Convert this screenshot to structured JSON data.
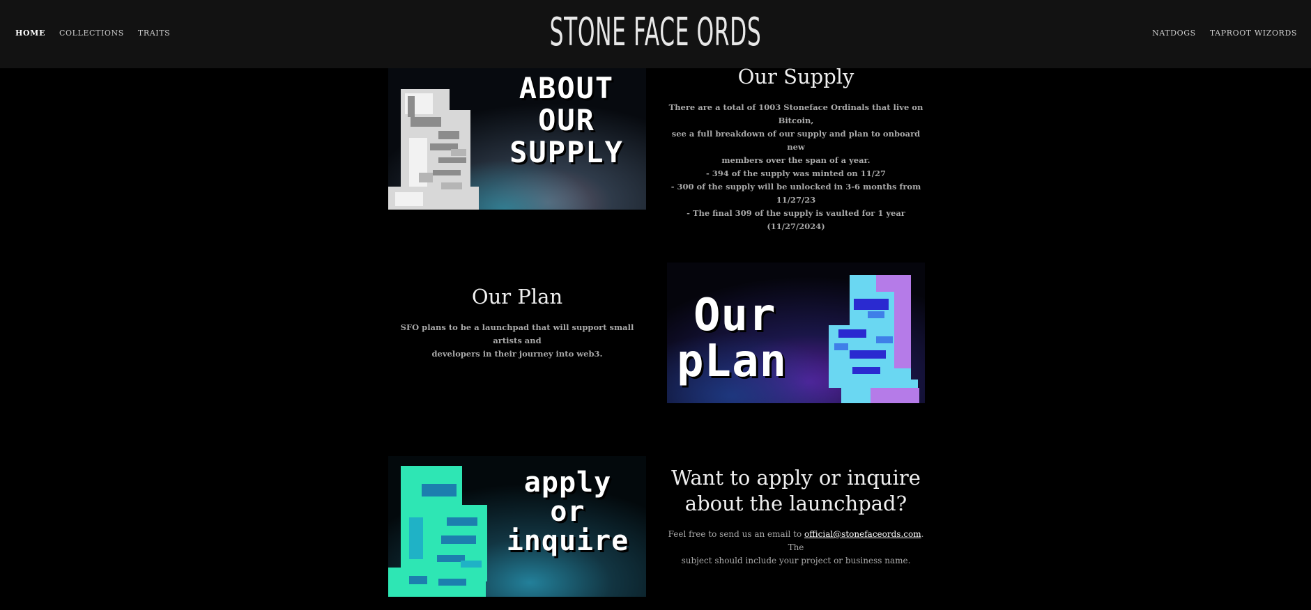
{
  "header": {
    "logo": "STONE FACE ORDS",
    "nav_left": [
      {
        "label": "HOME",
        "active": true
      },
      {
        "label": "COLLECTIONS",
        "active": false
      },
      {
        "label": "TRAITS",
        "active": false
      }
    ],
    "nav_right": [
      {
        "label": "NATDOGS"
      },
      {
        "label": "TAPROOT WIZORDS"
      }
    ]
  },
  "supply": {
    "banner_lines": [
      "ABOUT",
      "OUR",
      "SUPPLY"
    ],
    "heading": "Our Supply",
    "body_lines": [
      "There are a total of 1003 Stoneface Ordinals that live on Bitcoin,",
      "see a full breakdown of our supply and plan to onboard new",
      "members over the span of a year.",
      "- 394 of the supply was minted on 11/27",
      "- 300 of the supply will be unlocked in 3-6 months from 11/27/23",
      "- The final 309 of the supply is vaulted for 1 year (11/27/2024)"
    ]
  },
  "plan": {
    "banner_lines": [
      "Our",
      "pLan"
    ],
    "heading": "Our Plan",
    "body_lines": [
      "SFO plans to be a launchpad that will support small artists and",
      "developers in their journey into web3."
    ]
  },
  "apply": {
    "banner_lines": [
      "apply",
      "or",
      "inquire"
    ],
    "heading_lines": [
      "Want to apply or inquire",
      "about the launchpad?"
    ],
    "body_prefix": "Feel free to send us an email to ",
    "email": "official@stonefaceords.com",
    "body_suffix_line1": ". The",
    "body_line2": "subject should include your project or business name."
  },
  "colors": {
    "background": "#000000",
    "header": "#121212",
    "supply_statue": "#dcdcdc",
    "plan_statue": "#6ad7f2",
    "plan_accent": "#b57be8",
    "apply_statue": "#2ee6b4",
    "apply_accent": "#1c7fae"
  }
}
